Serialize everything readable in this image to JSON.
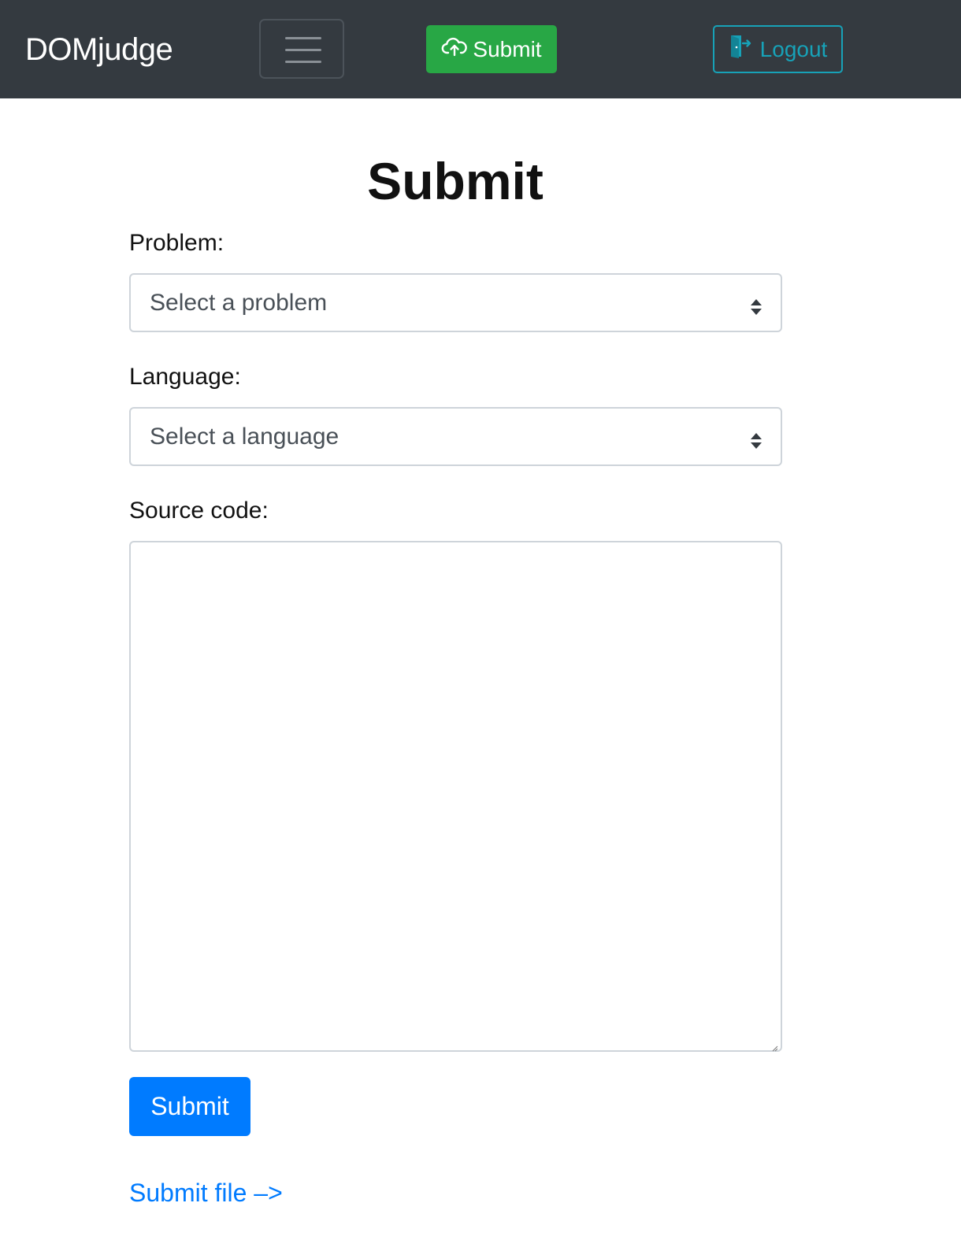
{
  "navbar": {
    "brand": "DOMjudge",
    "toggler_icon": "hamburger-menu-icon",
    "submit_button": {
      "label": "Submit",
      "icon": "cloud-upload-icon",
      "color": "#28a745"
    },
    "logout_button": {
      "label": "Logout",
      "icon": "door-exit-icon",
      "color": "#17a2b8"
    },
    "background_color": "#343a40"
  },
  "main": {
    "title": "Submit",
    "problem": {
      "label": "Problem:",
      "placeholder": "Select a problem"
    },
    "language": {
      "label": "Language:",
      "placeholder": "Select a language"
    },
    "source": {
      "label": "Source code:",
      "value": ""
    },
    "submit_button": {
      "label": "Submit",
      "color": "#007bff"
    },
    "submit_file_link": "Submit file –>"
  }
}
